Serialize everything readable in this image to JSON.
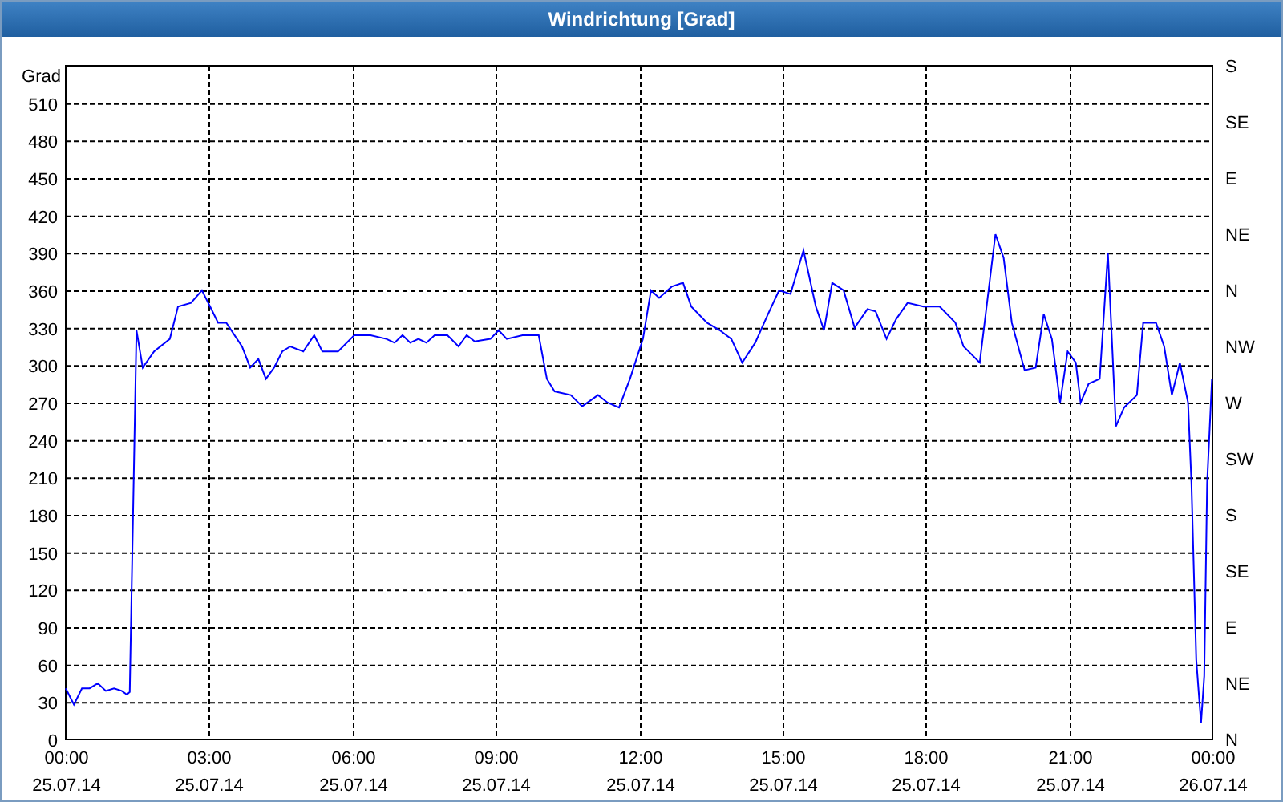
{
  "window": {
    "title": "Windrichtung [Grad]"
  },
  "chart_data": {
    "type": "line",
    "grid": true,
    "ylabel": "Grad",
    "xlim": [
      0,
      24
    ],
    "ylim": [
      0,
      540
    ],
    "xticks": [
      {
        "value": 0,
        "label": "00:00"
      },
      {
        "value": 3,
        "label": "03:00"
      },
      {
        "value": 6,
        "label": "06:00"
      },
      {
        "value": 9,
        "label": "09:00"
      },
      {
        "value": 12,
        "label": "12:00"
      },
      {
        "value": 15,
        "label": "15:00"
      },
      {
        "value": 18,
        "label": "18:00"
      },
      {
        "value": 21,
        "label": "21:00"
      },
      {
        "value": 24,
        "label": "00:00"
      }
    ],
    "yticks": [
      0,
      30,
      60,
      90,
      120,
      150,
      180,
      210,
      240,
      270,
      300,
      330,
      360,
      390,
      420,
      450,
      480,
      510
    ],
    "x": [
      0,
      0.17,
      0.34,
      0.5,
      0.67,
      0.84,
      1.01,
      1.17,
      1.28,
      1.34,
      1.48,
      1.61,
      1.85,
      2.18,
      2.35,
      2.62,
      2.85,
      3.02,
      3.19,
      3.36,
      3.69,
      3.86,
      4.03,
      4.19,
      4.36,
      4.53,
      4.7,
      4.97,
      5.2,
      5.37,
      5.7,
      6.04,
      6.38,
      6.71,
      6.88,
      7.05,
      7.21,
      7.38,
      7.55,
      7.72,
      7.99,
      8.22,
      8.39,
      8.56,
      8.89,
      9.06,
      9.23,
      9.56,
      9.9,
      10.07,
      10.23,
      10.57,
      10.81,
      11.14,
      11.34,
      11.58,
      11.81,
      12.08,
      12.25,
      12.42,
      12.68,
      12.92,
      13.09,
      13.42,
      13.69,
      13.93,
      14.16,
      14.43,
      14.7,
      14.93,
      15.17,
      15.44,
      15.7,
      15.87,
      16.04,
      16.28,
      16.51,
      16.78,
      16.95,
      17.18,
      17.38,
      17.62,
      17.95,
      18.29,
      18.62,
      18.79,
      19.13,
      19.46,
      19.63,
      19.8,
      20.07,
      20.3,
      20.47,
      20.64,
      20.81,
      20.97,
      21.14,
      21.24,
      21.41,
      21.64,
      21.81,
      21.98,
      22.15,
      22.42,
      22.55,
      22.82,
      22.99,
      23.15,
      23.32,
      23.49,
      23.56,
      23.66,
      23.76,
      23.83,
      23.89,
      23.99
    ],
    "series": [
      {
        "color": "#0000ff",
        "values": [
          41,
          28,
          41,
          41,
          45,
          39,
          41,
          39,
          36,
          38,
          328,
          298,
          311,
          321,
          347,
          350,
          360,
          347,
          334,
          334,
          315,
          298,
          305,
          289,
          298,
          311,
          315,
          311,
          324,
          311,
          311,
          324,
          324,
          321,
          318,
          324,
          318,
          321,
          318,
          324,
          324,
          315,
          324,
          319,
          321,
          328,
          321,
          324,
          324,
          289,
          279,
          276,
          267,
          276,
          270,
          266,
          289,
          321,
          360,
          354,
          363,
          366,
          347,
          334,
          328,
          321,
          302,
          318,
          341,
          360,
          357,
          392,
          347,
          328,
          366,
          360,
          330,
          345,
          343,
          321,
          337,
          350,
          347,
          347,
          334,
          315,
          302,
          405,
          386,
          334,
          296,
          298,
          341,
          321,
          270,
          311,
          302,
          270,
          285,
          289,
          390,
          251,
          266,
          276,
          334,
          334,
          315,
          276,
          302,
          270,
          206,
          64,
          13,
          51,
          206,
          289
        ]
      }
    ]
  },
  "date_labels": [
    "25.07.14",
    "25.07.14",
    "25.07.14",
    "25.07.14",
    "25.07.14",
    "25.07.14",
    "25.07.14",
    "25.07.14",
    "26.07.14"
  ],
  "compass_labels": [
    "S",
    "SE",
    "E",
    "NE",
    "N",
    "NW",
    "W",
    "SW",
    "S",
    "SE",
    "E",
    "NE",
    "N"
  ]
}
